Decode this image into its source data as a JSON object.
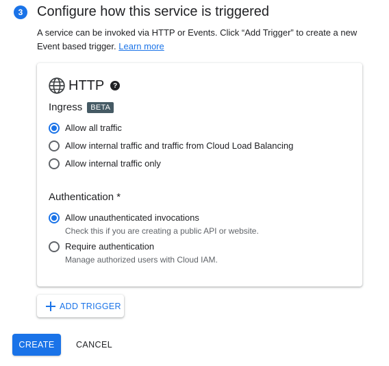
{
  "step": {
    "number": "3",
    "title": "Configure how this service is triggered",
    "description": "A service can be invoked via HTTP or Events. Click “Add Trigger” to create a new Event based trigger.",
    "learn_more": "Learn more"
  },
  "http_card": {
    "icon": "globe-icon",
    "title": "HTTP",
    "help_icon": "help-icon",
    "ingress": {
      "label": "Ingress",
      "badge": "BETA",
      "options": [
        {
          "label": "Allow all traffic",
          "selected": true
        },
        {
          "label": "Allow internal traffic and traffic from Cloud Load Balancing",
          "selected": false
        },
        {
          "label": "Allow internal traffic only",
          "selected": false
        }
      ]
    },
    "authentication": {
      "label": "Authentication *",
      "options": [
        {
          "label": "Allow unauthenticated invocations",
          "hint": "Check this if you are creating a public API or website.",
          "selected": true
        },
        {
          "label": "Require authentication",
          "hint": "Manage authorized users with Cloud IAM.",
          "selected": false
        }
      ]
    }
  },
  "add_trigger": {
    "icon": "plus-icon",
    "label": "ADD TRIGGER"
  },
  "actions": {
    "create": "CREATE",
    "cancel": "CANCEL"
  },
  "colors": {
    "accent": "#1a73e8",
    "badge": "#455a64",
    "text": "#202124",
    "hint": "#5f6368"
  }
}
